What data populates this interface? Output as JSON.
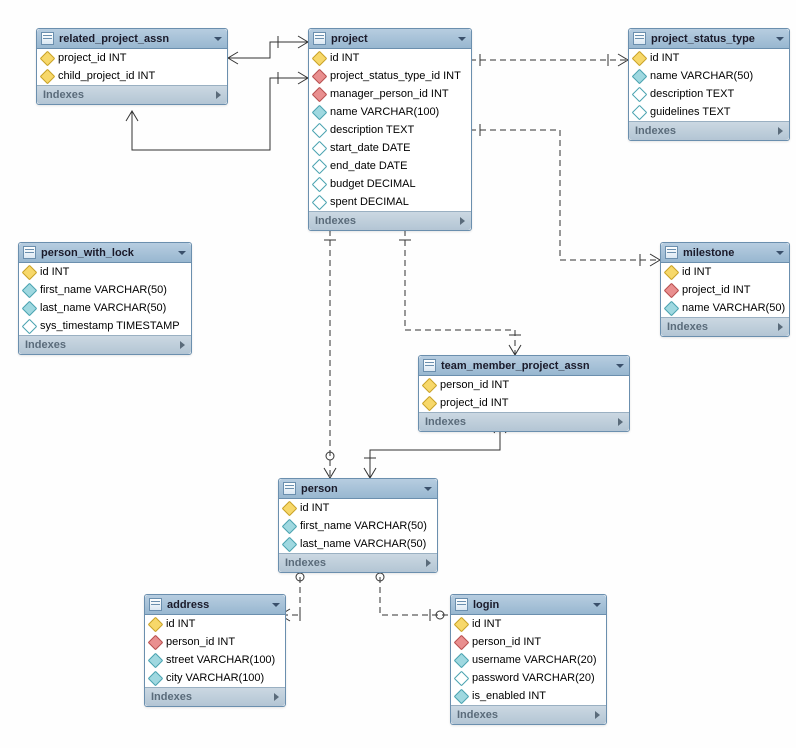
{
  "labels": {
    "indexes": "Indexes"
  },
  "tables": {
    "related_project_assn": {
      "title": "related_project_assn",
      "cols": [
        {
          "icon": "pk",
          "t": "project_id INT"
        },
        {
          "icon": "pk",
          "t": "child_project_id INT"
        }
      ]
    },
    "project": {
      "title": "project",
      "cols": [
        {
          "icon": "pk",
          "t": "id INT"
        },
        {
          "icon": "fk",
          "t": "project_status_type_id INT"
        },
        {
          "icon": "fk",
          "t": "manager_person_id INT"
        },
        {
          "icon": "attr",
          "t": "name VARCHAR(100)"
        },
        {
          "icon": "attr-open",
          "t": "description TEXT"
        },
        {
          "icon": "attr-open",
          "t": "start_date DATE"
        },
        {
          "icon": "attr-open",
          "t": "end_date DATE"
        },
        {
          "icon": "attr-open",
          "t": "budget DECIMAL"
        },
        {
          "icon": "attr-open",
          "t": "spent DECIMAL"
        }
      ]
    },
    "project_status_type": {
      "title": "project_status_type",
      "cols": [
        {
          "icon": "pk",
          "t": "id INT"
        },
        {
          "icon": "attr",
          "t": "name VARCHAR(50)"
        },
        {
          "icon": "attr-open",
          "t": "description TEXT"
        },
        {
          "icon": "attr-open",
          "t": "guidelines TEXT"
        }
      ]
    },
    "person_with_lock": {
      "title": "person_with_lock",
      "cols": [
        {
          "icon": "pk",
          "t": "id INT"
        },
        {
          "icon": "attr",
          "t": "first_name VARCHAR(50)"
        },
        {
          "icon": "attr",
          "t": "last_name VARCHAR(50)"
        },
        {
          "icon": "attr-open",
          "t": "sys_timestamp TIMESTAMP"
        }
      ]
    },
    "milestone": {
      "title": "milestone",
      "cols": [
        {
          "icon": "pk",
          "t": "id INT"
        },
        {
          "icon": "fk",
          "t": "project_id INT"
        },
        {
          "icon": "attr",
          "t": "name VARCHAR(50)"
        }
      ]
    },
    "team_member_project_assn": {
      "title": "team_member_project_assn",
      "cols": [
        {
          "icon": "pk",
          "t": "person_id INT"
        },
        {
          "icon": "pk",
          "t": "project_id INT"
        }
      ]
    },
    "person": {
      "title": "person",
      "cols": [
        {
          "icon": "pk",
          "t": "id INT"
        },
        {
          "icon": "attr",
          "t": "first_name VARCHAR(50)"
        },
        {
          "icon": "attr",
          "t": "last_name VARCHAR(50)"
        }
      ]
    },
    "address": {
      "title": "address",
      "cols": [
        {
          "icon": "pk",
          "t": "id INT"
        },
        {
          "icon": "fk",
          "t": "person_id INT"
        },
        {
          "icon": "attr",
          "t": "street VARCHAR(100)"
        },
        {
          "icon": "attr",
          "t": "city VARCHAR(100)"
        }
      ]
    },
    "login": {
      "title": "login",
      "cols": [
        {
          "icon": "pk",
          "t": "id INT"
        },
        {
          "icon": "fk",
          "t": "person_id INT"
        },
        {
          "icon": "attr",
          "t": "username VARCHAR(20)"
        },
        {
          "icon": "attr-open",
          "t": "password VARCHAR(20)"
        },
        {
          "icon": "attr",
          "t": "is_enabled INT"
        }
      ]
    }
  }
}
